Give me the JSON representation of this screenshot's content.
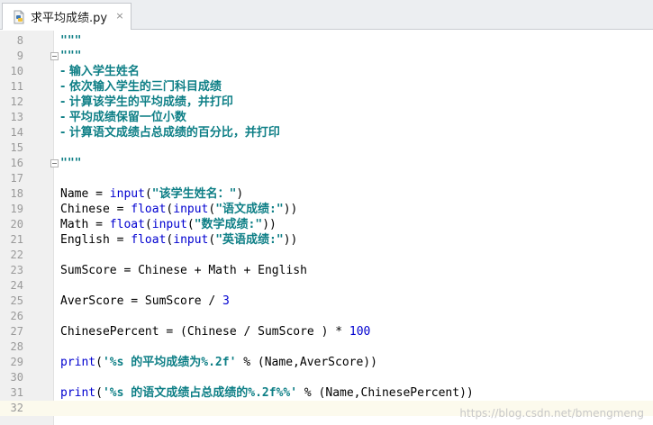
{
  "tab": {
    "label": "求平均成绩.py",
    "close": "×",
    "icon": "python-file-icon"
  },
  "colors": {
    "docstring": "#0e7f86",
    "builtin": "#0000d0",
    "gutter": "#f0f0f0",
    "current_line": "#fcfaed"
  },
  "lines": [
    {
      "n": "8",
      "text": "\"\"\""
    },
    {
      "n": "9",
      "text": "\"\"\""
    },
    {
      "n": "10",
      "text": "- 输入学生姓名"
    },
    {
      "n": "11",
      "text": "- 依次输入学生的三门科目成绩"
    },
    {
      "n": "12",
      "text": "- 计算该学生的平均成绩，并打印"
    },
    {
      "n": "13",
      "text": "- 平均成绩保留一位小数"
    },
    {
      "n": "14",
      "text": "- 计算语文成绩占总成绩的百分比，并打印"
    },
    {
      "n": "15",
      "text": ""
    },
    {
      "n": "16",
      "text": "\"\"\""
    },
    {
      "n": "17",
      "text": ""
    },
    {
      "n": "18",
      "pre": "Name = ",
      "fn": "input",
      "open": "(",
      "str": "\"该学生姓名：\"",
      "close": ")"
    },
    {
      "n": "19",
      "pre": "Chinese = ",
      "fn": "float",
      "open": "(",
      "fn2": "input",
      "open2": "(",
      "str": "\"语文成绩:\"",
      "close": "))"
    },
    {
      "n": "20",
      "pre": "Math = ",
      "fn": "float",
      "open": "(",
      "fn2": "input",
      "open2": "(",
      "str": "\"数学成绩:\"",
      "close": "))"
    },
    {
      "n": "21",
      "pre": "English = ",
      "fn": "float",
      "open": "(",
      "fn2": "input",
      "open2": "(",
      "str": "\"英语成绩:\"",
      "close": "))"
    },
    {
      "n": "22",
      "text": ""
    },
    {
      "n": "23",
      "text": "SumScore = Chinese + Math + English"
    },
    {
      "n": "24",
      "text": ""
    },
    {
      "n": "25",
      "pre": "AverScore = SumScore / ",
      "num": "3"
    },
    {
      "n": "26",
      "text": ""
    },
    {
      "n": "27",
      "pre": "ChinesePercent = (Chinese / SumScore ) * ",
      "num": "100"
    },
    {
      "n": "28",
      "text": ""
    },
    {
      "n": "29",
      "fn": "print",
      "open": "(",
      "str": "'%s 的平均成绩为%.2f'",
      "rest": " % (Name,AverScore))"
    },
    {
      "n": "30",
      "text": ""
    },
    {
      "n": "31",
      "fn": "print",
      "open": "(",
      "str": "'%s 的语文成绩占总成绩的%.2f%%'",
      "rest": " % (Name,ChinesePercent))"
    },
    {
      "n": "32",
      "text": ""
    }
  ],
  "watermark": "https://blog.csdn.net/bmengmeng"
}
